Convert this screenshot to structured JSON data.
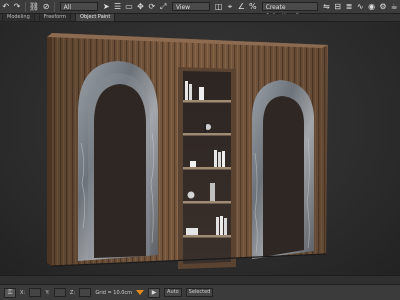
{
  "toolbar": {
    "combo_selection": "All",
    "combo_view": "View",
    "combo_named_sets": "Create Selection Se"
  },
  "ribbon": {
    "tabs": [
      {
        "label": "Modeling",
        "active": false
      },
      {
        "label": "Freeform",
        "active": false
      },
      {
        "label": "Object Paint",
        "active": true
      }
    ]
  },
  "status": {
    "mode_label": "Auto",
    "set_key_label": "Selected",
    "x_label": "X:",
    "y_label": "Y:",
    "z_label": "Z:",
    "grid_label": "Grid = 10.0cm"
  },
  "colors": {
    "wood": "#7a5a40",
    "marble": "#8a8e95",
    "dark_door": "#2f2724",
    "accent": "#e08a1e"
  }
}
